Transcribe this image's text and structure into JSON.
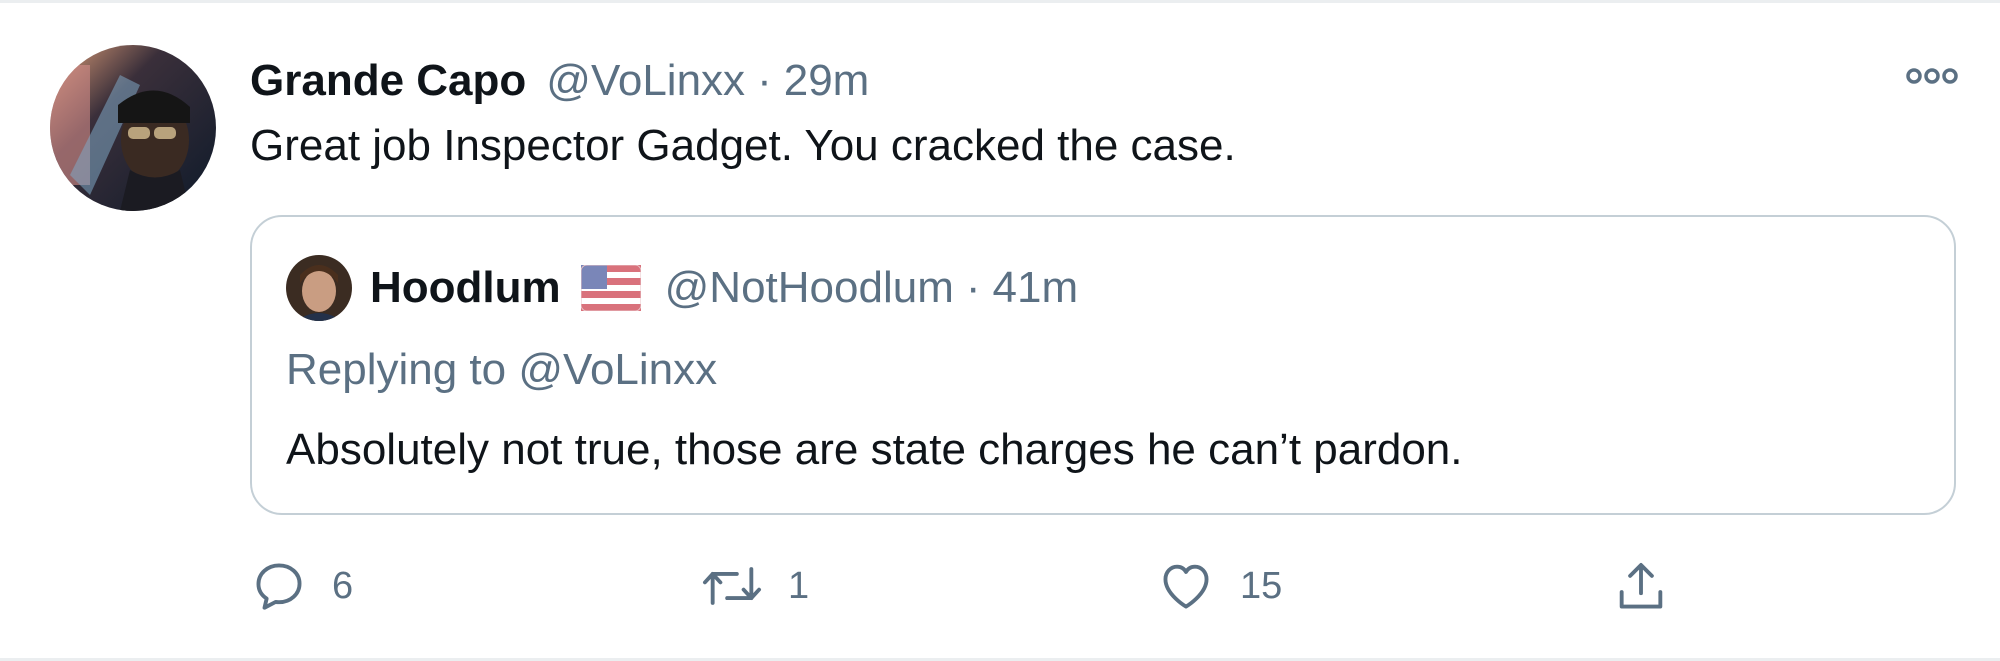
{
  "tweet": {
    "author": {
      "name": "Grande Capo",
      "handle": "@VoLinxx"
    },
    "separator": "·",
    "time": "29m",
    "text": "Great job Inspector Gadget. You cracked the case.",
    "more_icon": "more-dots-icon"
  },
  "quote": {
    "author": {
      "name": "Hoodlum",
      "flag_icon": "us-flag-icon",
      "handle": "@NotHoodlum"
    },
    "separator": "·",
    "time": "41m",
    "replying_prefix": "Replying to",
    "replying_handle": "@VoLinxx",
    "text": "Absolutely not true, those are state charges he can’t pardon."
  },
  "actions": {
    "reply": {
      "icon": "reply-icon",
      "count": "6"
    },
    "retweet": {
      "icon": "retweet-icon",
      "count": "1"
    },
    "like": {
      "icon": "heart-icon",
      "count": "15"
    },
    "share": {
      "icon": "share-icon"
    }
  },
  "colors": {
    "primary_text": "#0f1419",
    "secondary_text": "#5b7083",
    "border": "#c4cfd6",
    "divider": "#ebeef0"
  }
}
